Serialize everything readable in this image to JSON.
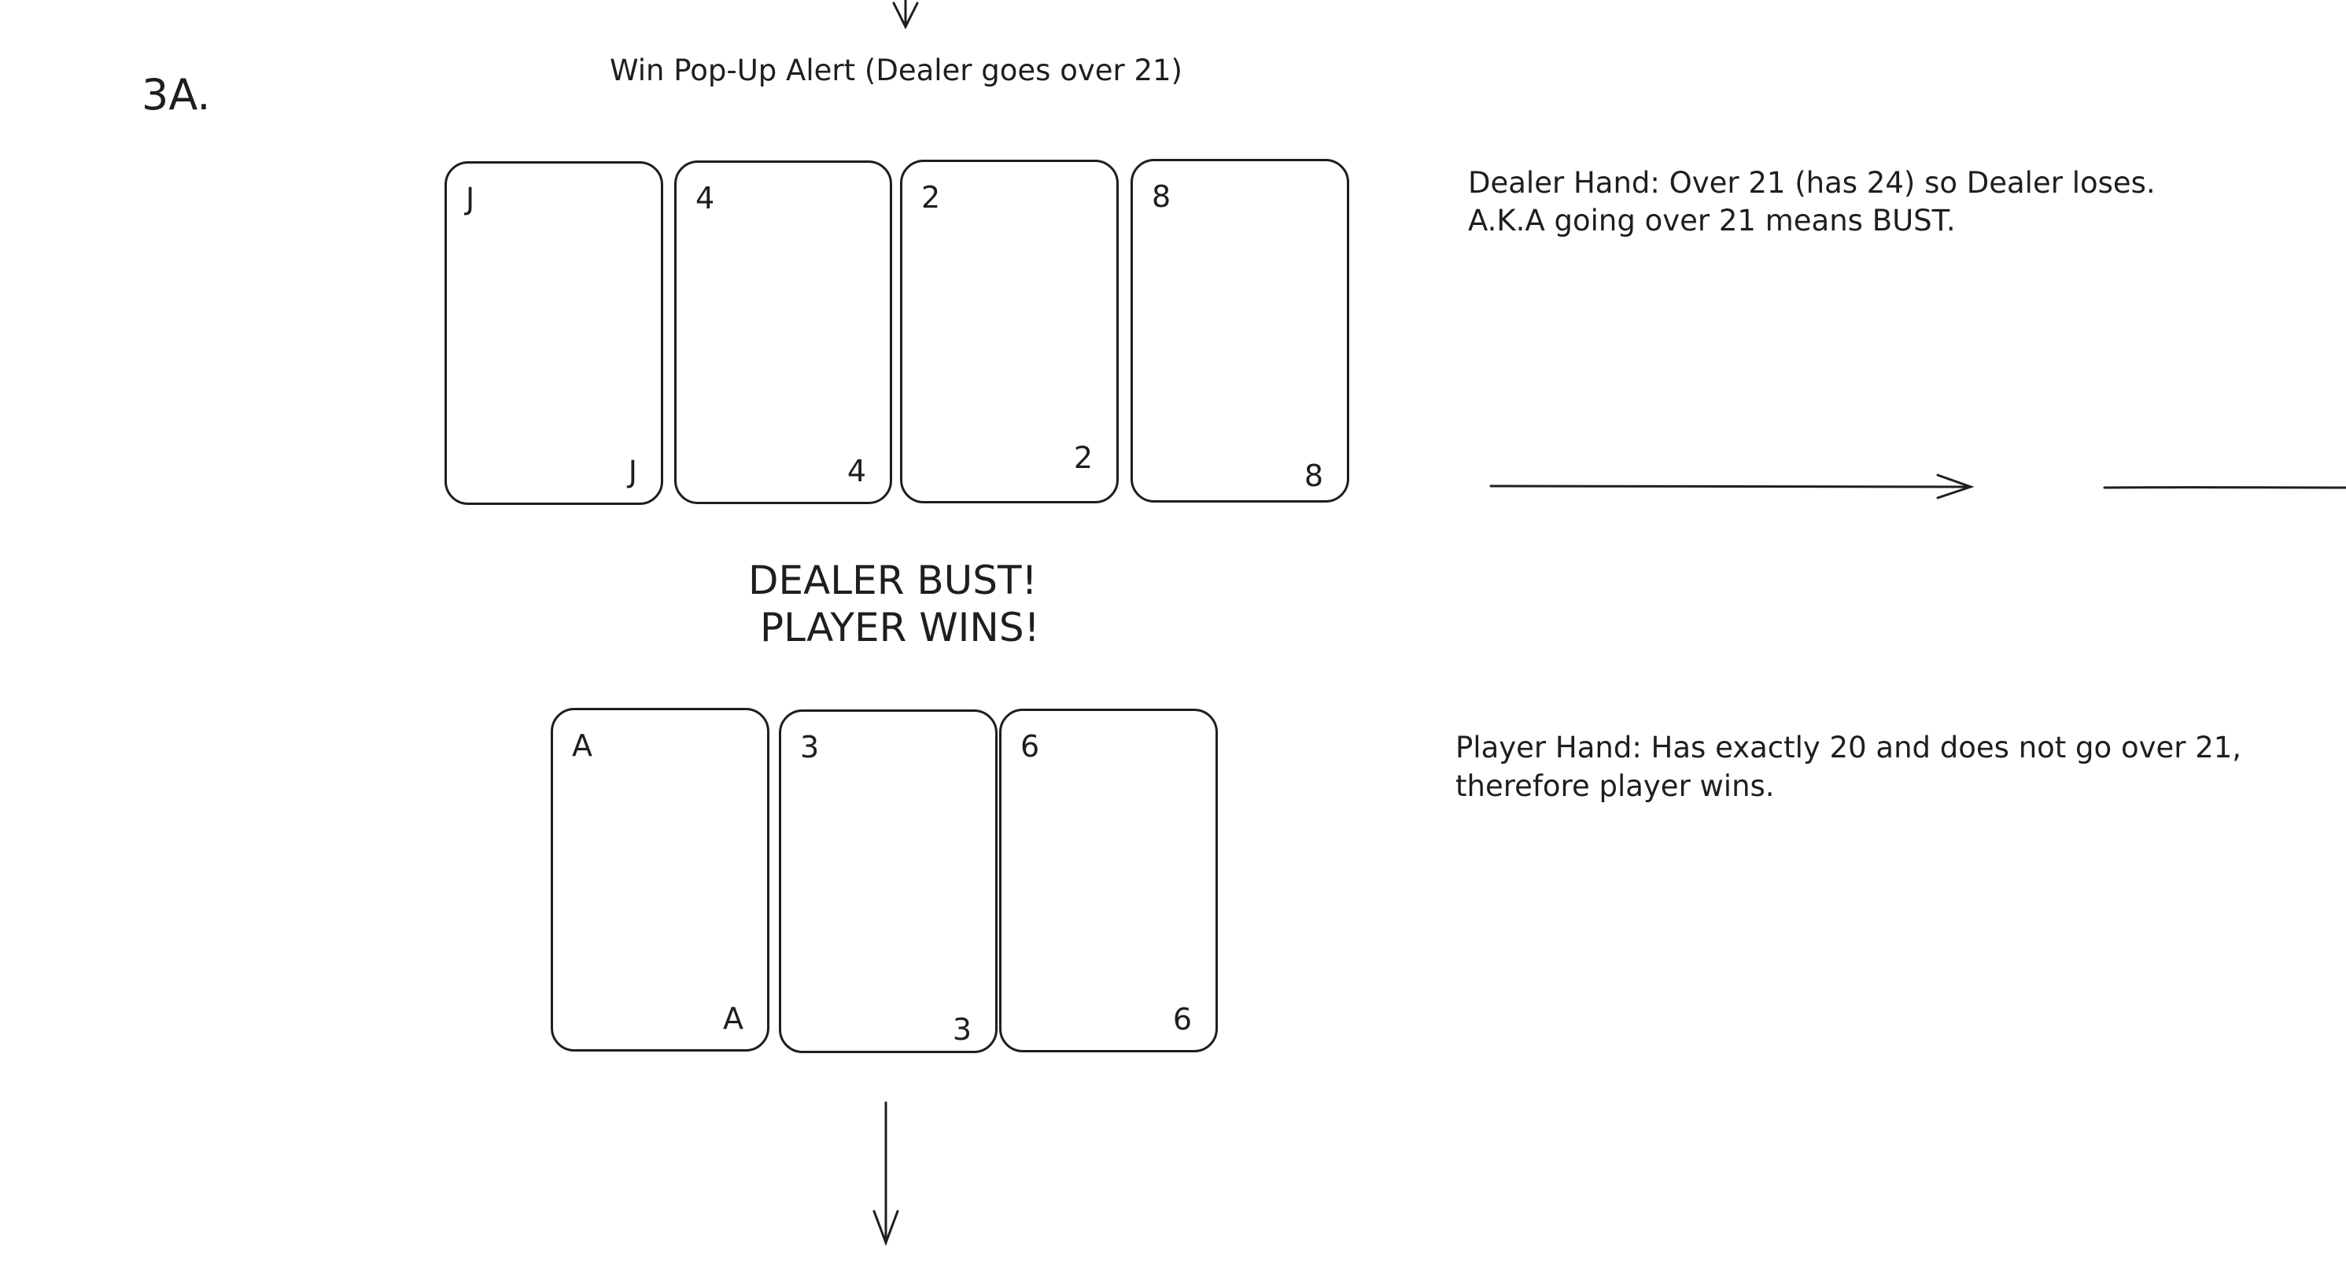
{
  "step_label": "3A.",
  "title": "Win Pop-Up Alert (Dealer goes over 21)",
  "dealer": {
    "cards": [
      "J",
      "4",
      "2",
      "8"
    ],
    "note_lines": [
      "Dealer Hand: Over 21 (has 24) so Dealer loses.",
      "A.K.A going over 21 means BUST."
    ]
  },
  "alert": {
    "line1": "DEALER BUST!",
    "line2": "PLAYER WINS!"
  },
  "player": {
    "cards": [
      "A",
      "3",
      "6"
    ],
    "note_lines": [
      "Player Hand: Has exactly 20 and does not go over 21,",
      "therefore player wins."
    ]
  },
  "icons": {
    "top_arrow": "arrow-down-icon",
    "bottom_arrow": "arrow-down-icon",
    "right_arrow": "arrow-right-icon"
  },
  "colors": {
    "stroke": "#1e1e1e",
    "background": "#ffffff"
  }
}
